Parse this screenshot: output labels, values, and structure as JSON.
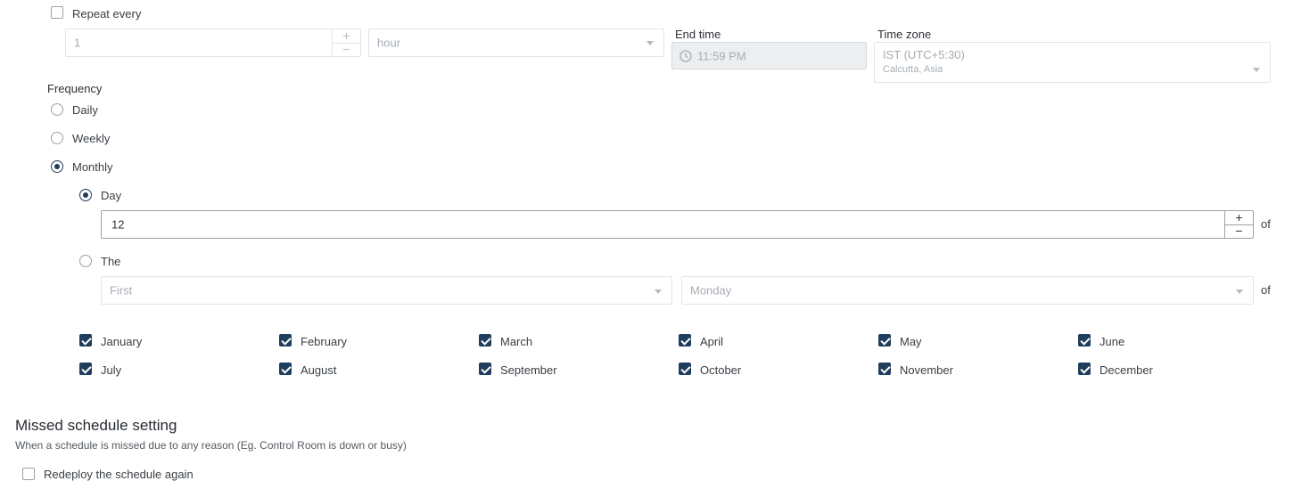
{
  "repeat": {
    "checkbox_label": "Repeat every",
    "interval_value": "1",
    "unit_value": "hour",
    "end_time_label": "End time",
    "end_time_value": "11:59 PM",
    "timezone_label": "Time zone",
    "timezone_value": "IST (UTC+5:30)",
    "timezone_region": "Calcutta, Asia"
  },
  "frequency": {
    "label": "Frequency",
    "daily": "Daily",
    "weekly": "Weekly",
    "monthly": "Monthly",
    "selected": "Monthly"
  },
  "monthly": {
    "day_label": "Day",
    "day_value": "12",
    "of_label": "of",
    "the_label": "The",
    "ordinal_value": "First",
    "weekday_value": "Monday",
    "selected": "Day"
  },
  "months": [
    "January",
    "February",
    "March",
    "April",
    "May",
    "June",
    "July",
    "August",
    "September",
    "October",
    "November",
    "December"
  ],
  "missed": {
    "title": "Missed schedule setting",
    "description": "When a schedule is missed due to any reason (Eg. Control Room is down or busy)",
    "redeploy_label": "Redeploy the schedule again"
  },
  "colors": {
    "accent": "#1f3d5c",
    "border": "#d5d9dd",
    "disabled_text": "#a7adb3"
  }
}
